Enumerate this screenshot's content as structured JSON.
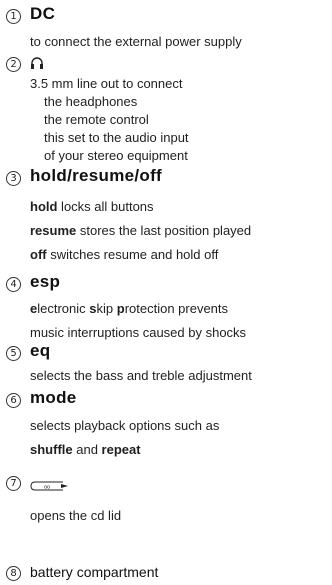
{
  "items": [
    {
      "num": "1",
      "heading": "DC",
      "lines": [
        "to connect the external power supply"
      ]
    },
    {
      "num": "2",
      "icon": "headphones-icon",
      "lines": [
        "3.5 mm line out to connect",
        "the headphones",
        "the remote control",
        "this set to the audio input",
        "of your stereo equipment"
      ]
    },
    {
      "num": "3",
      "heading": "hold/resume/off",
      "rows": [
        {
          "bold": "hold",
          "text": " locks all buttons"
        },
        {
          "bold": "resume",
          "text": " stores the last position played"
        },
        {
          "bold": "off",
          "text": " switches resume and hold off"
        }
      ]
    },
    {
      "num": "4",
      "heading": "esp",
      "row1": {
        "b1": "e",
        "t1": "lectronic ",
        "b2": "s",
        "t2": "kip ",
        "b3": "p",
        "t3": "rotection prevents"
      },
      "line2": "music interruptions caused by shocks"
    },
    {
      "num": "5",
      "heading": "eq",
      "lines": [
        "selects the bass and treble adjustment"
      ]
    },
    {
      "num": "6",
      "heading": "mode",
      "line1": "selects playback options such as",
      "row2": {
        "b1": "shuffle",
        "t": " and ",
        "b2": "repeat"
      }
    },
    {
      "num": "7",
      "icon": "cd-lid-open-icon",
      "lines": [
        "opens the cd lid"
      ]
    },
    {
      "num": "8",
      "heading": "battery compartment"
    }
  ]
}
